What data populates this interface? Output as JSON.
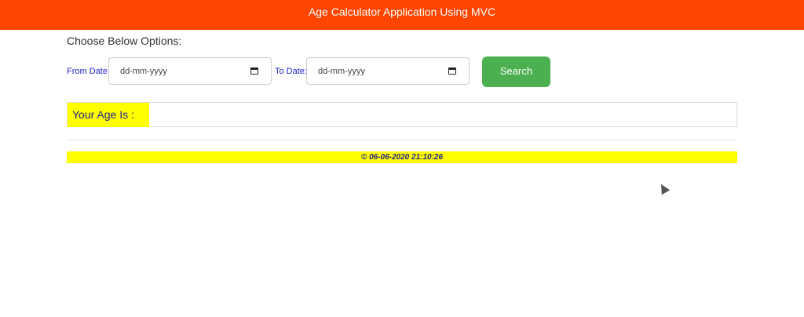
{
  "header": {
    "title": "Age Calculator Application Using MVC"
  },
  "form": {
    "heading": "Choose Below Options:",
    "from_label": "From Date:",
    "from_placeholder": "dd-mm-yyyy",
    "to_label": "To Date:",
    "to_placeholder": "dd-mm-yyyy",
    "search_label": "Search"
  },
  "result": {
    "label": "Your Age Is :",
    "value": ""
  },
  "footer": {
    "text": "© 06-06-2020 21:10:26"
  }
}
